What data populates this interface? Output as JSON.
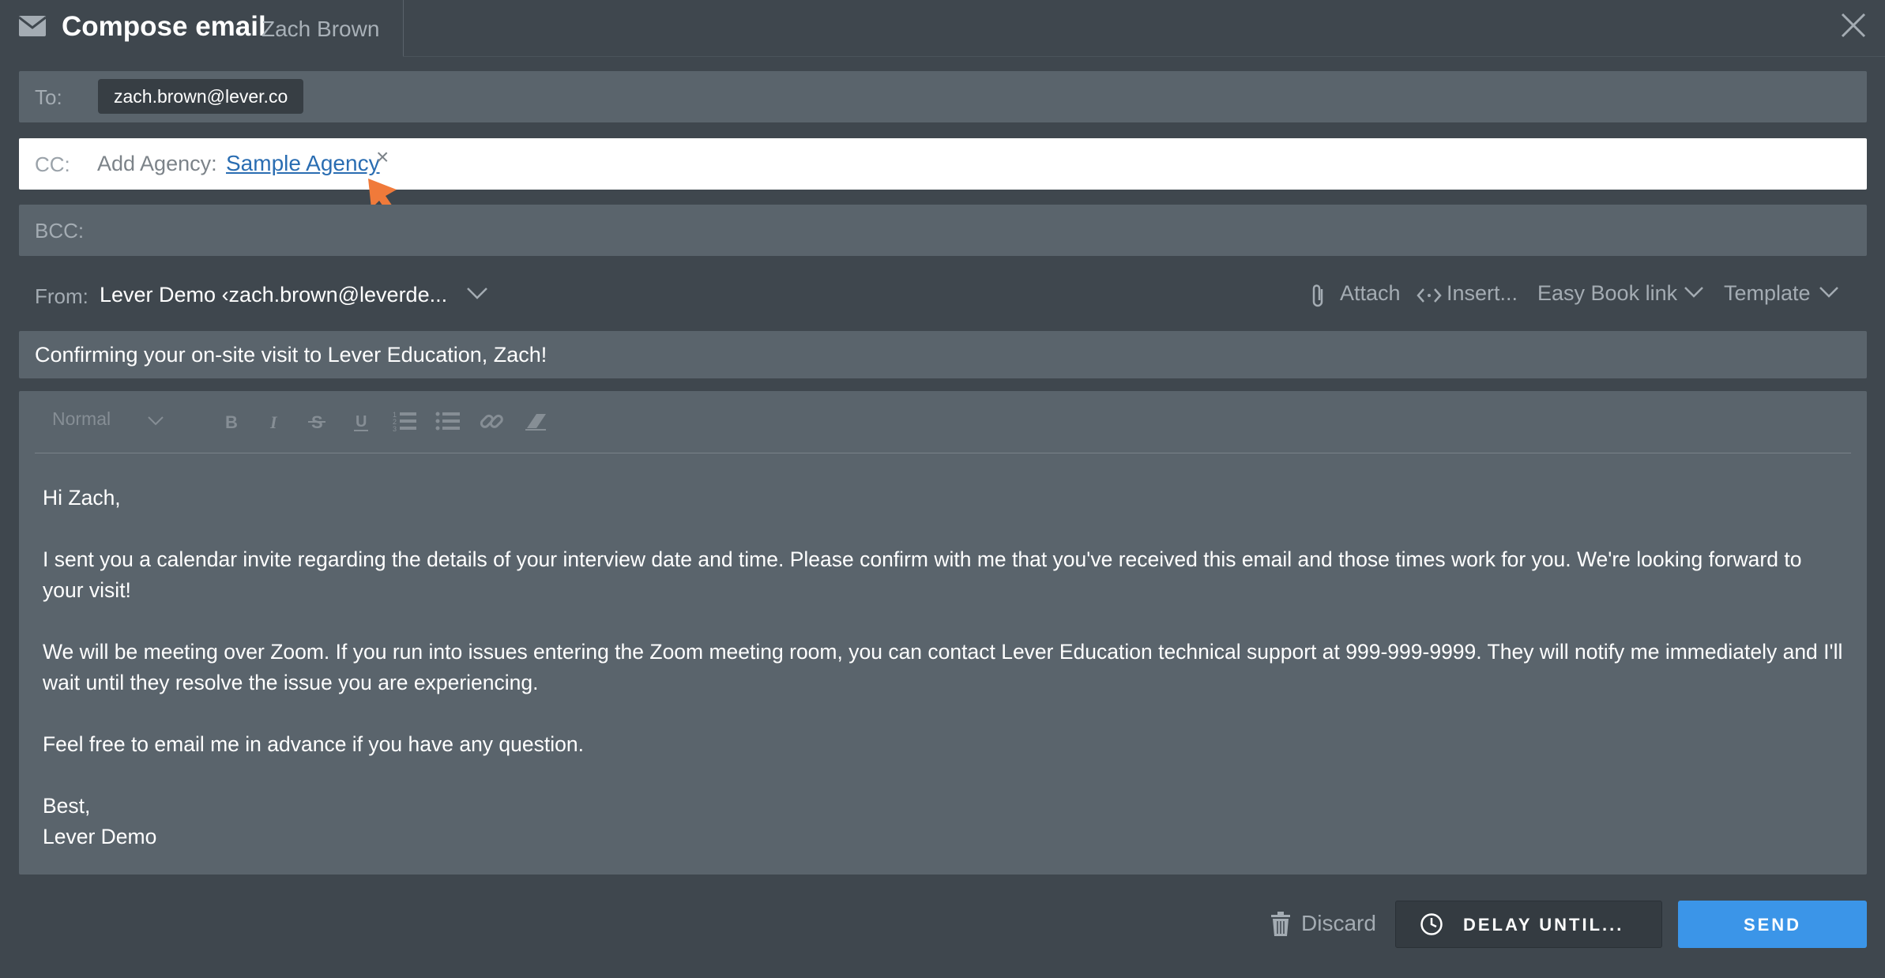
{
  "header": {
    "title": "Compose email",
    "subtitle": "Zach Brown"
  },
  "to": {
    "label": "To:",
    "recipient": "zach.brown@lever.co"
  },
  "cc": {
    "label": "CC:",
    "add_agency_label": "Add Agency:",
    "agency_name": "Sample Agency",
    "remove_glyph": "×"
  },
  "bcc": {
    "label": "BCC:"
  },
  "from": {
    "label": "From:",
    "value": "Lever Demo ‹zach.brown@leverde..."
  },
  "toolbar": {
    "attach_label": "Attach",
    "insert_label": "Insert...",
    "easy_book_label": "Easy Book link",
    "template_label": "Template"
  },
  "subject": {
    "value": "Confirming your on-site visit to Lever Education, Zach!"
  },
  "editor": {
    "format_label": "Normal",
    "icons": [
      "bold-icon",
      "italic-icon",
      "strikethrough-icon",
      "underline-icon",
      "ordered-list-icon",
      "bullet-list-icon",
      "link-icon",
      "clear-format-icon"
    ],
    "body": {
      "greeting": "Hi Zach,",
      "para1": "I sent you a calendar invite regarding the details of your interview date and time. Please confirm with me that you've received this email and those times work for you. We're looking forward to your visit!",
      "para2": "We will be meeting over Zoom. If you run into issues entering the Zoom meeting room, you can contact Lever Education technical support at 999-999-9999. They will notify me immediately and I'll wait until they resolve the issue you are experiencing.",
      "para3": "Feel free to email me in advance if you have any question.",
      "signoff": "Best,",
      "signature": "Lever Demo"
    }
  },
  "footer": {
    "discard_label": "Discard",
    "delay_label": "DELAY UNTIL...",
    "send_label": "SEND"
  },
  "colors": {
    "background": "#3f474e",
    "field": "#5a646c",
    "link": "#2a6db2",
    "send": "#3b95e8",
    "annotation_arrow": "#f07a3a"
  }
}
